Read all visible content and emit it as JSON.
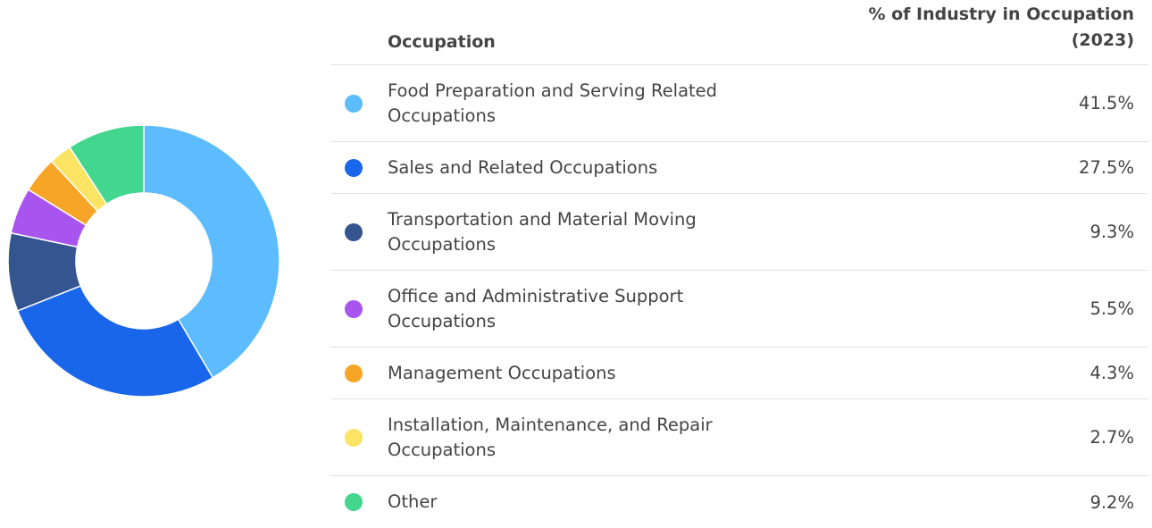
{
  "table": {
    "header_occupation": "Occupation",
    "header_percent_line1": "% of Industry in Occupation",
    "header_percent_line2": "(2023)"
  },
  "chart_data": {
    "type": "pie",
    "subtype": "donut",
    "categories": [
      "Food Preparation and Serving Related Occupations",
      "Sales and Related Occupations",
      "Transportation and Material Moving Occupations",
      "Office and Administrative Support Occupations",
      "Management Occupations",
      "Installation, Maintenance, and Repair Occupations",
      "Other"
    ],
    "values": [
      41.5,
      27.5,
      9.3,
      5.5,
      4.3,
      2.7,
      9.2
    ],
    "value_labels": [
      "41.5%",
      "27.5%",
      "9.3%",
      "5.5%",
      "4.3%",
      "2.7%",
      "9.2%"
    ],
    "colors": [
      "#5cbcff",
      "#1a66ea",
      "#34558f",
      "#a855f0",
      "#f6a526",
      "#fbe363",
      "#43d68e"
    ],
    "label_lines": [
      [
        "Food Preparation and Serving Related",
        "Occupations"
      ],
      [
        "Sales and Related Occupations"
      ],
      [
        "Transportation and Material Moving",
        "Occupations"
      ],
      [
        "Office and Administrative Support",
        "Occupations"
      ],
      [
        "Management Occupations"
      ],
      [
        "Installation, Maintenance, and Repair",
        "Occupations"
      ],
      [
        "Other"
      ]
    ],
    "legend_placement": "right"
  }
}
